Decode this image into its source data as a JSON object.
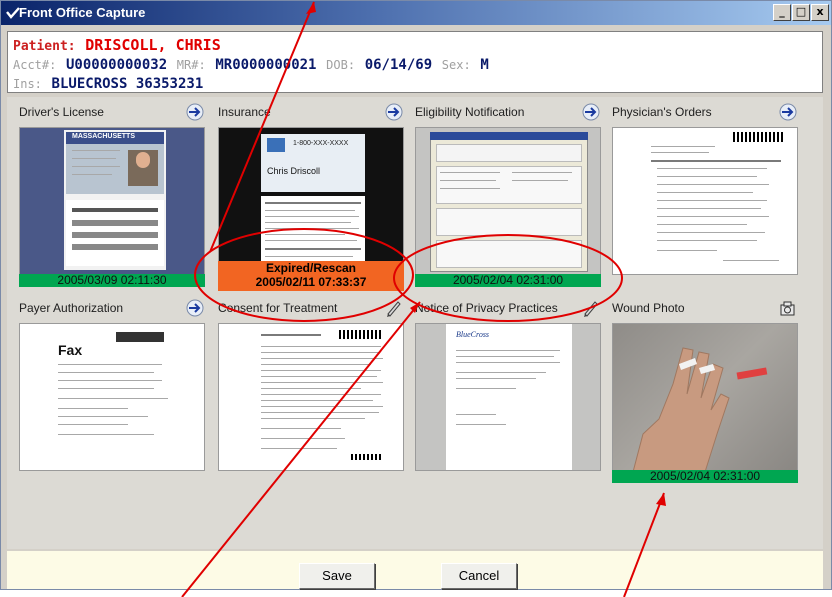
{
  "window": {
    "title": "Front Office Capture",
    "controls": {
      "minimize": "_",
      "maximize": "□",
      "close": "x"
    }
  },
  "patient": {
    "patient_label": "Patient:",
    "patient_name": "DRISCOLL, CHRIS",
    "acct_label": "Acct#:",
    "acct_value": "U00000000032",
    "mr_label": "MR#:",
    "mr_value": "MR0000000021",
    "dob_label": "DOB:",
    "dob_value": "06/14/69",
    "sex_label": "Sex:",
    "sex_value": "M",
    "ins_label": "Ins:",
    "ins_value": "BLUECROSS 36353231"
  },
  "documents": [
    {
      "title": "Driver's License",
      "stamp": "2005/03/09 02:11:30",
      "action_icon": "scan-arrow-icon"
    },
    {
      "title": "Insurance",
      "stamp_line1": "Expired/Rescan",
      "stamp_line2": "2005/02/11 07:33:37",
      "action_icon": "scan-arrow-icon"
    },
    {
      "title": "Eligibility Notification",
      "stamp": "2005/02/04 02:31:00",
      "action_icon": "scan-arrow-icon"
    },
    {
      "title": "Physician's Orders",
      "action_icon": "scan-arrow-icon"
    },
    {
      "title": "Payer Authorization",
      "action_icon": "scan-arrow-icon",
      "fax_label": "Fax"
    },
    {
      "title": "Consent for Treatment",
      "action_icon": "sign-pen-icon"
    },
    {
      "title": "Notice of Privacy Practices",
      "action_icon": "sign-pen-icon"
    },
    {
      "title": "Wound Photo",
      "stamp": "2005/02/04 02:31:00",
      "action_icon": "camera-icon"
    }
  ],
  "thumbnail_text": {
    "license_state": "MASSACHUSETTS",
    "insurance_name": "Chris Driscoll",
    "insurance_phone": "1-800-XXX-XXXX",
    "notice_logo": "BlueCross"
  },
  "buttons": {
    "save": "Save",
    "cancel": "Cancel"
  },
  "colors": {
    "stamp_valid": "#00a651",
    "stamp_expired": "#f26522",
    "annotation_red": "#e00000",
    "title_bar": "#0a246a"
  }
}
